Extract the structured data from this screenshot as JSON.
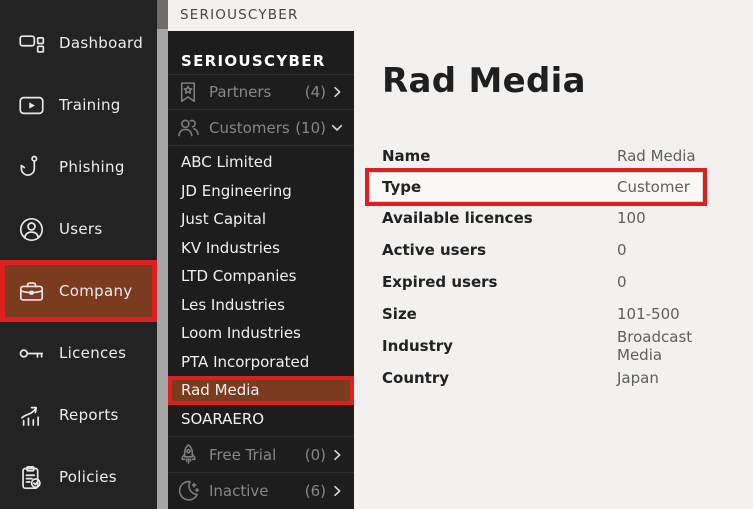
{
  "topbar": {
    "brand": "SERIOUSCYBER"
  },
  "sidebar": {
    "items": [
      {
        "label": "Dashboard",
        "icon": "dashboard-icon",
        "active": false
      },
      {
        "label": "Training",
        "icon": "video-play-icon",
        "active": false
      },
      {
        "label": "Phishing",
        "icon": "fish-hook-icon",
        "active": false
      },
      {
        "label": "Users",
        "icon": "user-circle-icon",
        "active": false
      },
      {
        "label": "Company",
        "icon": "briefcase-icon",
        "active": true,
        "annotated": true
      },
      {
        "label": "Licences",
        "icon": "key-icon",
        "active": false
      },
      {
        "label": "Reports",
        "icon": "chart-growth-icon",
        "active": false
      },
      {
        "label": "Policies",
        "icon": "clipboard-check-icon",
        "active": false
      }
    ]
  },
  "company_panel": {
    "title": "SERIOUSCYBER",
    "groups": [
      {
        "label": "Partners",
        "count": "(4)",
        "icon": "bookmark-star-icon",
        "chevron": "right"
      },
      {
        "label": "Customers",
        "count": "(10)",
        "icon": "people-icon",
        "chevron": "down"
      }
    ],
    "customers": [
      "ABC Limited",
      "JD Engineering",
      "Just Capital",
      "KV Industries",
      "LTD Companies",
      "Les Industries",
      "Loom Industries",
      "PTA Incorporated",
      "Rad Media",
      "SOARAERO"
    ],
    "selected_customer": "Rad Media",
    "footer_groups": [
      {
        "label": "Free Trial",
        "count": "(0)",
        "icon": "rocket-icon",
        "chevron": "right"
      },
      {
        "label": "Inactive",
        "count": "(6)",
        "icon": "moon-icon",
        "chevron": "right"
      }
    ]
  },
  "main": {
    "title": "Rad Media",
    "details": [
      {
        "label": "Name",
        "value": "Rad Media"
      },
      {
        "label": "Type",
        "value": "Customer",
        "highlighted": true
      },
      {
        "label": "Available licences",
        "value": "100"
      },
      {
        "label": "Active users",
        "value": "0"
      },
      {
        "label": "Expired users",
        "value": "0"
      },
      {
        "label": "Size",
        "value": "101-500"
      },
      {
        "label": "Industry",
        "value": "Broadcast Media"
      },
      {
        "label": "Country",
        "value": "Japan"
      }
    ]
  },
  "colors": {
    "annotation_red": "#dc1f1f",
    "accent_brown": "#7a3b1e",
    "sidebar_bg": "#232323",
    "panel_bg": "#1d1d1d",
    "page_bg": "#f2f1f0"
  }
}
